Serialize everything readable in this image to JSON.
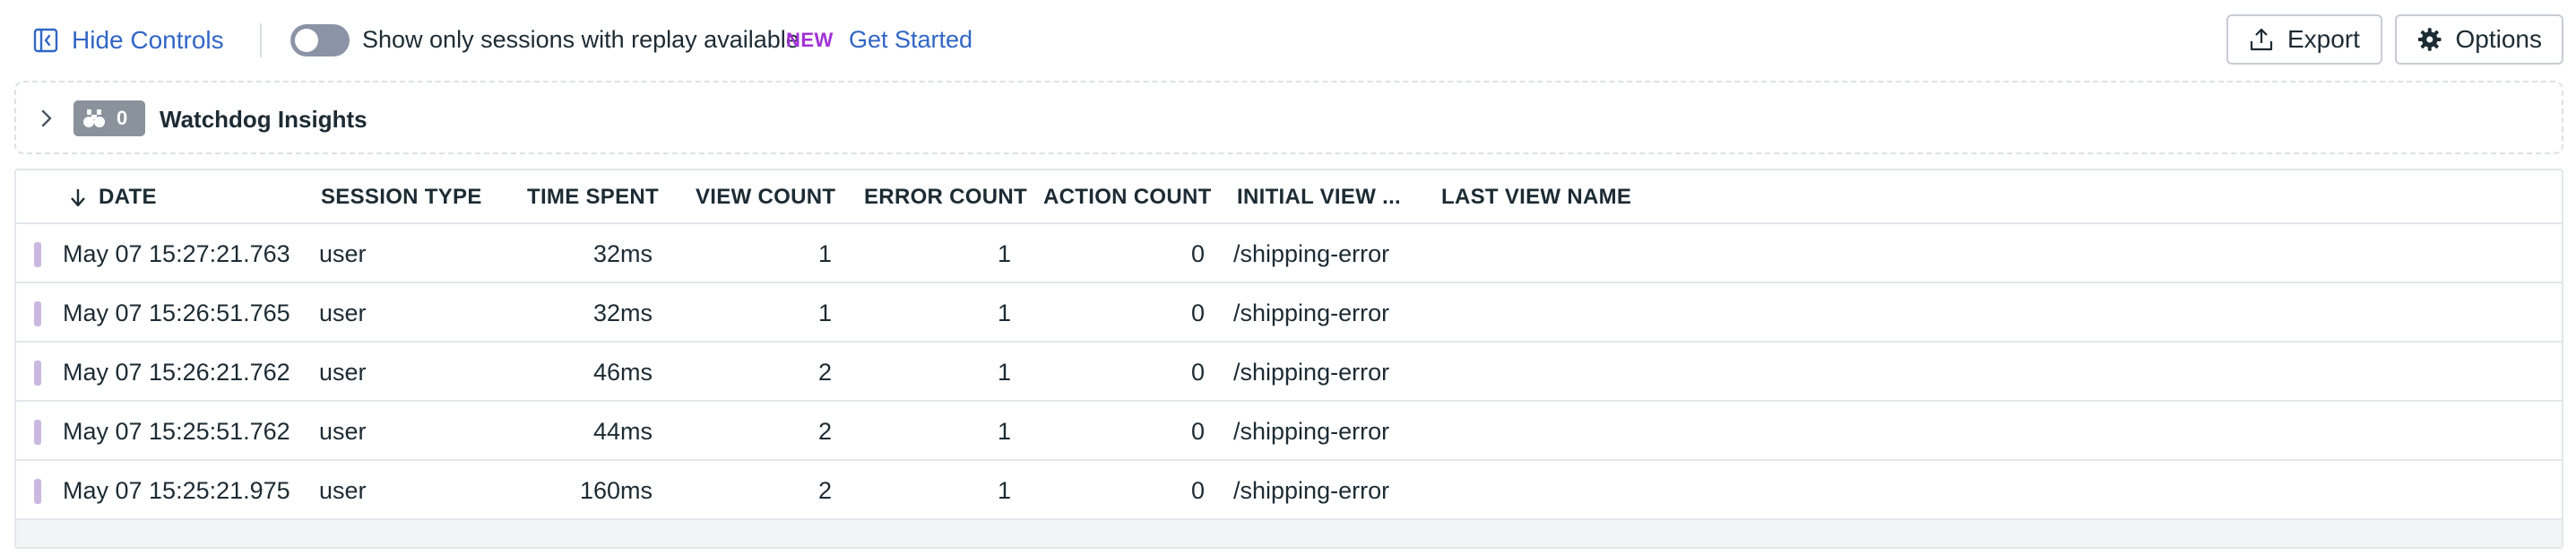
{
  "controls": {
    "hide_controls_label": "Hide Controls",
    "replay_toggle_label": "Show only sessions with replay available",
    "new_badge": "NEW",
    "get_started_label": "Get Started",
    "export_label": "Export",
    "options_label": "Options"
  },
  "watchdog": {
    "count": "0",
    "title": "Watchdog Insights"
  },
  "table": {
    "columns": {
      "date": "DATE",
      "session_type": "SESSION TYPE",
      "time_spent": "TIME SPENT",
      "view_count": "VIEW COUNT",
      "error_count": "ERROR COUNT",
      "action_count": "ACTION COUNT",
      "initial_view": "INITIAL VIEW ...",
      "last_view_name": "LAST VIEW NAME"
    },
    "rows": [
      {
        "date": "May 07 15:27:21.763",
        "session_type": "user",
        "time_spent": "32ms",
        "view_count": "1",
        "error_count": "1",
        "action_count": "0",
        "initial_view": "/shipping-error",
        "last_view_name": ""
      },
      {
        "date": "May 07 15:26:51.765",
        "session_type": "user",
        "time_spent": "32ms",
        "view_count": "1",
        "error_count": "1",
        "action_count": "0",
        "initial_view": "/shipping-error",
        "last_view_name": ""
      },
      {
        "date": "May 07 15:26:21.762",
        "session_type": "user",
        "time_spent": "46ms",
        "view_count": "2",
        "error_count": "1",
        "action_count": "0",
        "initial_view": "/shipping-error",
        "last_view_name": ""
      },
      {
        "date": "May 07 15:25:51.762",
        "session_type": "user",
        "time_spent": "44ms",
        "view_count": "2",
        "error_count": "1",
        "action_count": "0",
        "initial_view": "/shipping-error",
        "last_view_name": ""
      },
      {
        "date": "May 07 15:25:21.975",
        "session_type": "user",
        "time_spent": "160ms",
        "view_count": "2",
        "error_count": "1",
        "action_count": "0",
        "initial_view": "/shipping-error",
        "last_view_name": ""
      }
    ]
  },
  "colors": {
    "link": "#3166c6",
    "new_badge": "#a231d5",
    "row_marker": "#cbb8e1",
    "toggle_off": "#8a94a6"
  }
}
